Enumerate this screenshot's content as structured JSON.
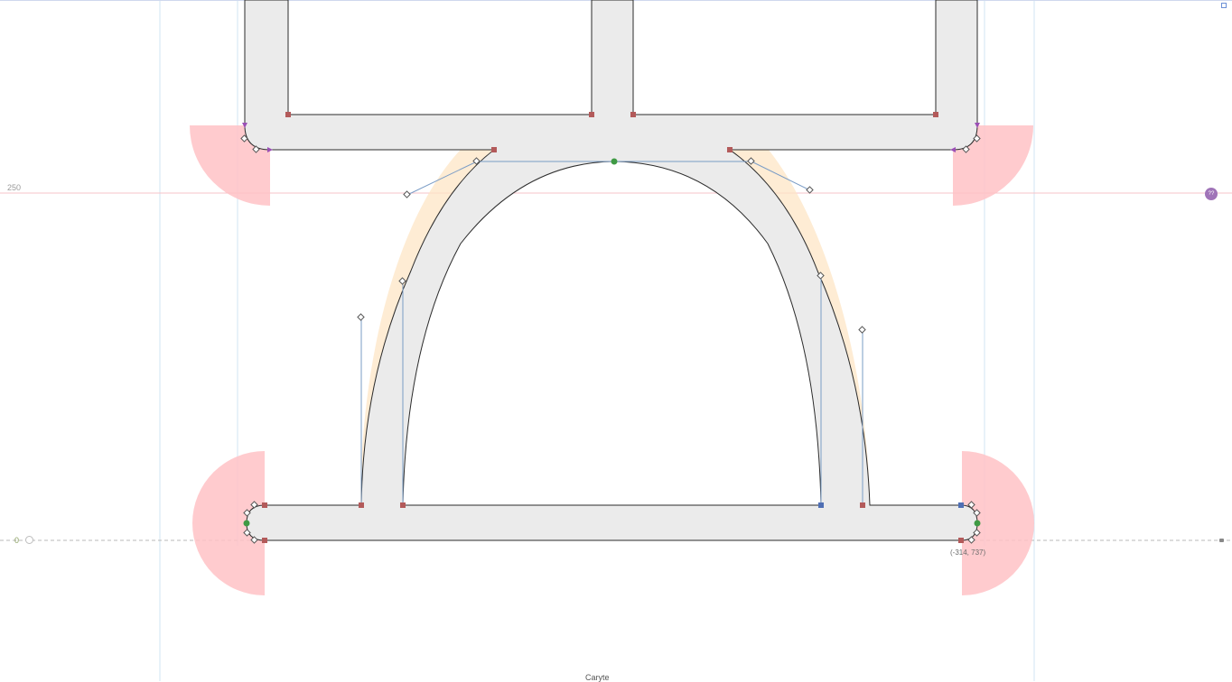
{
  "guides": {
    "metric_250_label": "250",
    "baseline_label": "0",
    "metric_badge_label": "??"
  },
  "selection": {
    "coordinates_label": "(-314, 737)"
  },
  "glyph": {
    "name": "Caryte"
  },
  "colors": {
    "glyph_fill": "#ececec",
    "outline": "#2b2b2b",
    "corner_zone": "#ffb8bd",
    "background_layer": "#fde9cc",
    "guide_red": "#f7b8bf",
    "guide_blue": "#c9e1f2",
    "node_red": "#a85050",
    "node_green": "#3f9a44",
    "handle_line": "#5b84b8",
    "metric_badge": "#a074b8"
  },
  "icons": [
    "corner-resize-icon",
    "lock-icon",
    "baseline-origin-icon",
    "metric-badge-icon"
  ]
}
